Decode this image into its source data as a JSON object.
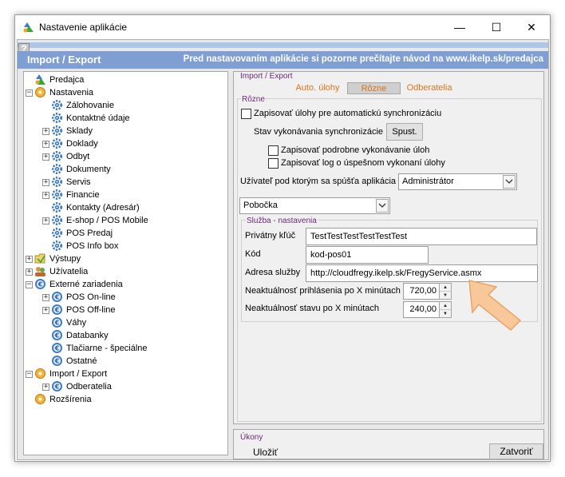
{
  "window": {
    "title": "Nastavenie aplikácie",
    "help": "?"
  },
  "controls": {
    "minimize": "—",
    "maximize": "☐",
    "close": "✕"
  },
  "banner": {
    "section": "Import / Export",
    "notice": "Pred nastavovaním aplikácie si pozorne prečítajte návod na www.ikelp.sk/predajca"
  },
  "tree": {
    "nodes": [
      {
        "label": "Predajca",
        "icon": "app-icon"
      },
      {
        "label": "Nastavenia",
        "icon": "gear-folder-icon",
        "expander": "−"
      },
      {
        "label": "Zálohovanie",
        "icon": "gear-icon"
      },
      {
        "label": "Kontaktné údaje",
        "icon": "gear-icon"
      },
      {
        "label": "Sklady",
        "icon": "gear-icon",
        "expander": "+"
      },
      {
        "label": "Doklady",
        "icon": "gear-icon",
        "expander": "+"
      },
      {
        "label": "Odbyt",
        "icon": "gear-icon",
        "expander": "+"
      },
      {
        "label": "Dokumenty",
        "icon": "gear-icon"
      },
      {
        "label": "Servis",
        "icon": "gear-icon",
        "expander": "+"
      },
      {
        "label": "Financie",
        "icon": "gear-icon",
        "expander": "+"
      },
      {
        "label": "Kontakty (Adresár)",
        "icon": "gear-icon"
      },
      {
        "label": "E-shop / POS Mobile",
        "icon": "gear-icon",
        "expander": "+"
      },
      {
        "label": "POS Predaj",
        "icon": "gear-icon"
      },
      {
        "label": "POS Info box",
        "icon": "gear-icon"
      },
      {
        "label": "Výstupy",
        "icon": "folder-icon",
        "expander": "+"
      },
      {
        "label": "Užívatelia",
        "icon": "users-icon",
        "expander": "+"
      },
      {
        "label": "Externé zariadenia",
        "icon": "device-icon",
        "expander": "−"
      },
      {
        "label": "POS On-line",
        "icon": "device-icon",
        "expander": "+"
      },
      {
        "label": "POS Off-line",
        "icon": "device-icon",
        "expander": "+"
      },
      {
        "label": "Váhy",
        "icon": "device-icon"
      },
      {
        "label": "Databanky",
        "icon": "device-icon"
      },
      {
        "label": "Tlačiarne - špeciálne",
        "icon": "device-icon"
      },
      {
        "label": "Ostatné",
        "icon": "device-icon"
      },
      {
        "label": "Import / Export",
        "icon": "gear-folder-icon",
        "expander": "−"
      },
      {
        "label": "Odberatelia",
        "icon": "device-icon",
        "expander": "+"
      },
      {
        "label": "Rozšírenia",
        "icon": "gear-folder-icon"
      }
    ]
  },
  "panel": {
    "label": "Import / Export",
    "tabs": [
      "Auto. úlohy",
      "Rôzne",
      "Odberatelia"
    ],
    "active_tab": "Rôzne",
    "group_label": "Rôzne",
    "chk_sync": "Zapisovať úlohy pre automatickú synchronizáciu",
    "sync_state_label": "Stav vykonávania synchronizácie",
    "start_button": "Spust.",
    "chk_detailed": "Zapisovať podrobne vykonávanie úloh",
    "chk_log": "Zapisovať log o úspešnom vykonaní úlohy",
    "user_label": "Užívateľ pod ktorým sa spúšťa aplikácia",
    "user_value": "Administrátor",
    "branch_value": "Pobočka",
    "service": {
      "label": "Služba - nastavenia",
      "private_key_label": "Privátny kľúč",
      "private_key_value": "TestTestTestTestTestTest",
      "code_label": "Kód",
      "code_value": "kod-pos01",
      "address_label": "Adresa služby",
      "address_value": "http://cloudfregy.ikelp.sk/FregyService.asmx",
      "login_timeout_label": "Neaktuálnosť prihlásenia po X minútach",
      "login_timeout_value": "720,00",
      "state_timeout_label": "Neaktuálnosť stavu po X minútach",
      "state_timeout_value": "240,00"
    }
  },
  "actions": {
    "label": "Úkony",
    "save": "Uložiť",
    "close": "Zatvoriť"
  },
  "colors": {
    "banner": "#7f9ed3",
    "stripe": "#aec6ea",
    "tab_text": "#d9761b",
    "group_label": "#6b2877",
    "arrow": "#f8c89a"
  }
}
